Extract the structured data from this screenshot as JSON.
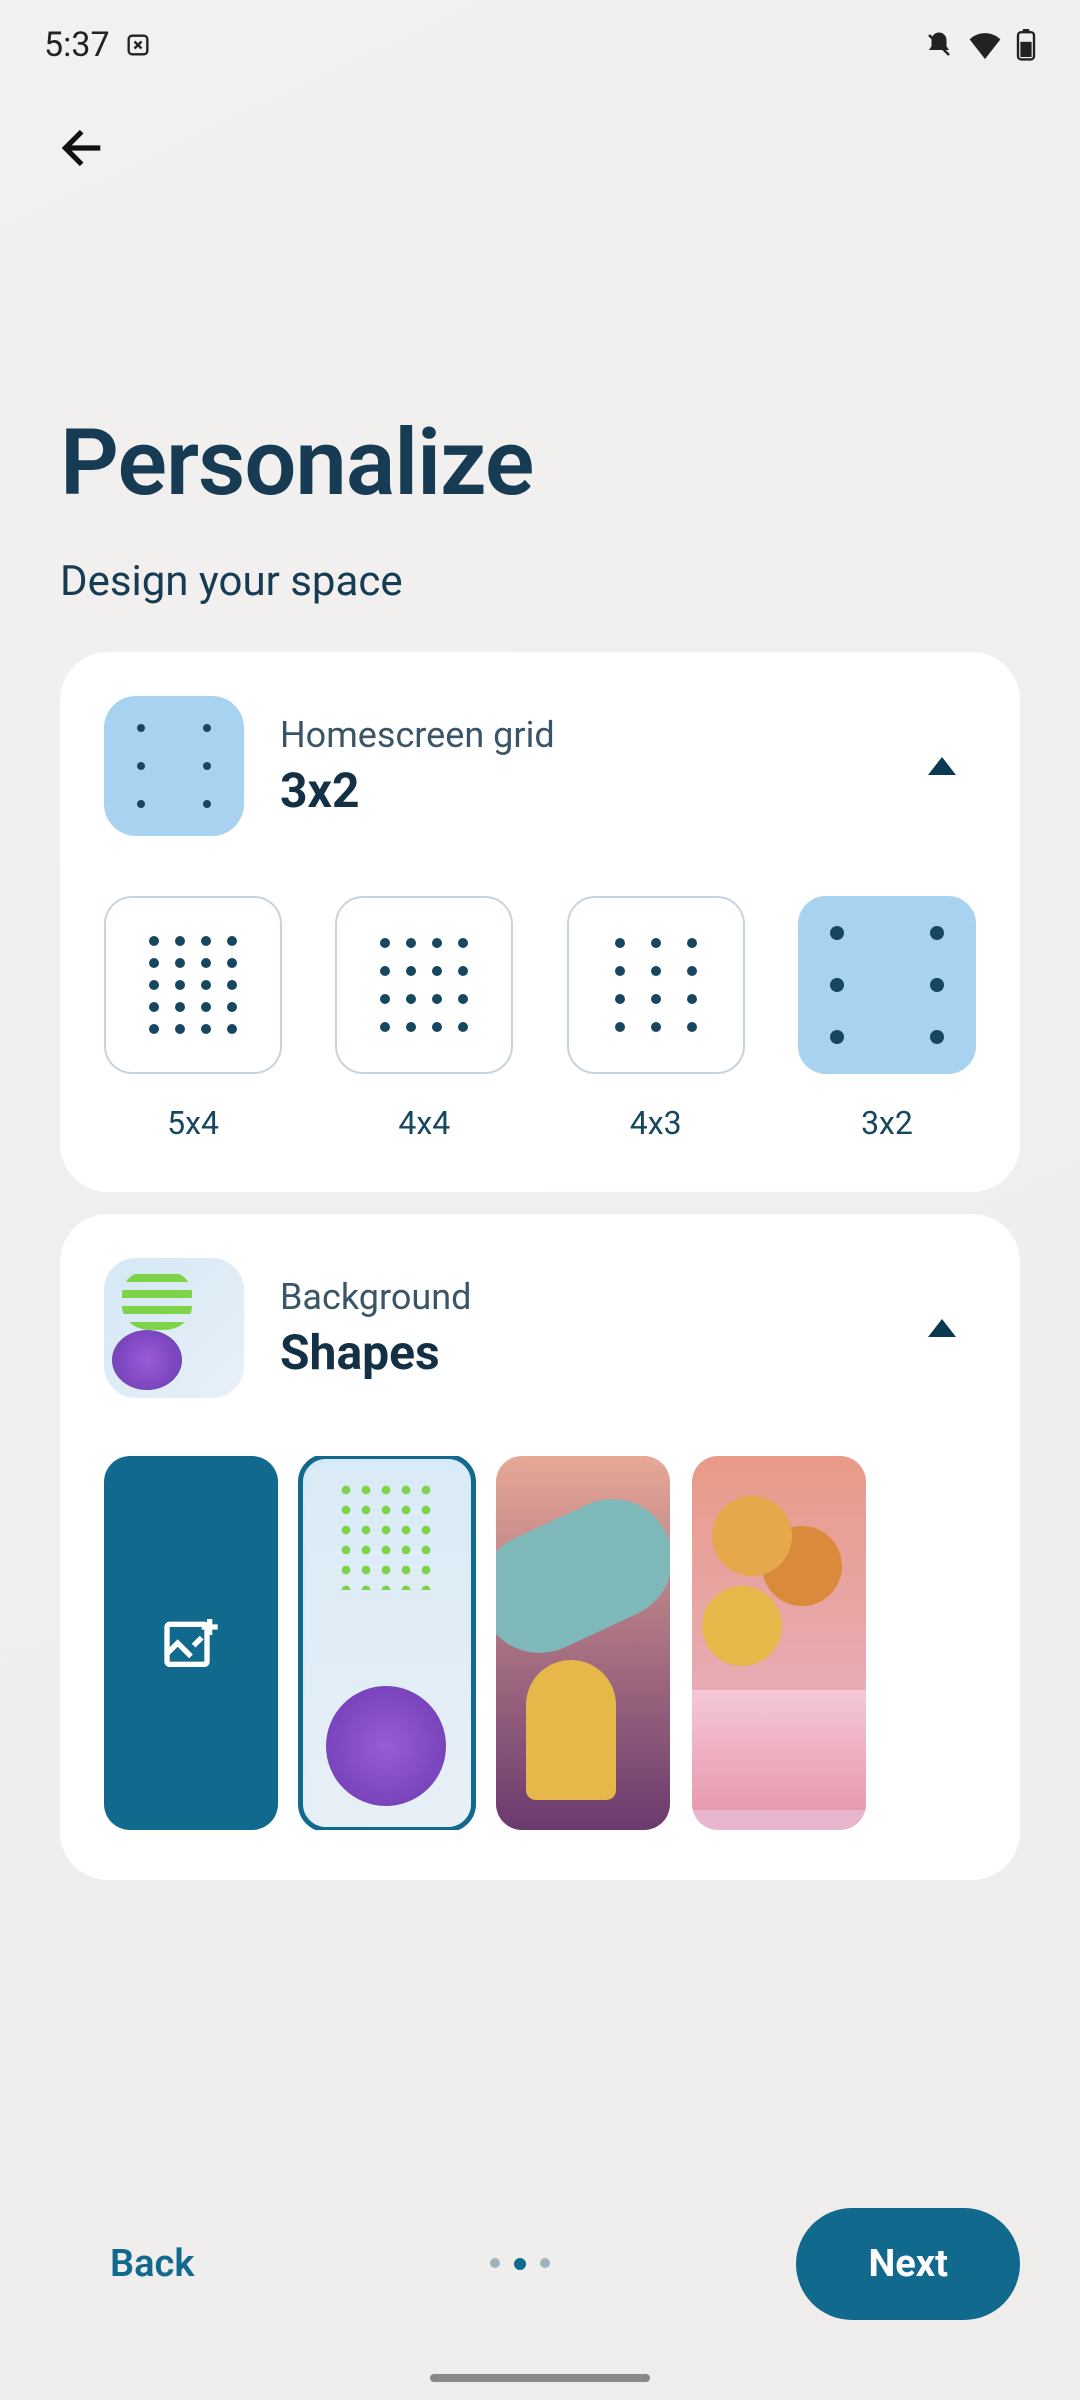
{
  "statusbar": {
    "time": "5:37"
  },
  "page": {
    "title": "Personalize",
    "subtitle": "Design your space"
  },
  "grid_section": {
    "label": "Homescreen grid",
    "value": "3x2",
    "options": [
      {
        "cols": 4,
        "rows": 5,
        "label": "5x4",
        "selected": false
      },
      {
        "cols": 4,
        "rows": 4,
        "label": "4x4",
        "selected": false
      },
      {
        "cols": 3,
        "rows": 4,
        "label": "4x3",
        "selected": false
      },
      {
        "cols": 2,
        "rows": 3,
        "label": "3x2",
        "selected": true
      }
    ]
  },
  "bg_section": {
    "label": "Background",
    "value": "Shapes",
    "wallpapers": [
      {
        "kind": "add"
      },
      {
        "kind": "shapes",
        "selected": true
      },
      {
        "kind": "abstract-purple"
      },
      {
        "kind": "trees-orange"
      }
    ]
  },
  "footer": {
    "back": "Back",
    "next": "Next",
    "page_index": 1,
    "page_count": 3
  }
}
